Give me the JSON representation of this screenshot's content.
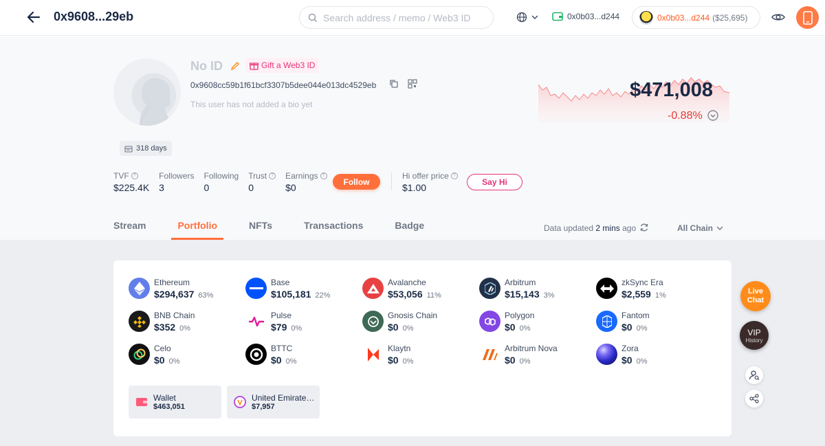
{
  "header": {
    "title": "0x9608...29eb",
    "search_placeholder": "Search address / memo / Web3 ID",
    "wallet_short": "0x0b03...d244",
    "account_addr": "0x0b03...d244",
    "account_value": "($25,695)"
  },
  "profile": {
    "name": "No ID",
    "gift_label": "Gift a Web3 ID",
    "address": "0x9608cc59b1f61bcf3307b5dee044e013dc4529eb",
    "bio": "This user has not added a bio yet",
    "days": "318 days",
    "net_worth": "$471,008",
    "change": "-0.88%",
    "stats": [
      {
        "label": "TVF",
        "value": "$225.4K"
      },
      {
        "label": "Followers",
        "value": "3"
      },
      {
        "label": "Following",
        "value": "0"
      },
      {
        "label": "Trust",
        "value": "0"
      },
      {
        "label": "Earnings",
        "value": "$0"
      }
    ],
    "follow_label": "Follow",
    "hi_offer_label": "Hi offer price",
    "hi_offer_value": "$1.00",
    "say_hi_label": "Say Hi"
  },
  "tabs": [
    "Stream",
    "Portfolio",
    "NFTs",
    "Transactions",
    "Badge"
  ],
  "data_updated": {
    "prefix": "Data updated",
    "time": "2 mins",
    "suffix": "ago"
  },
  "chain_filter": "All Chain",
  "chains": [
    {
      "name": "Ethereum",
      "value": "$294,637",
      "pct": "63%",
      "icon": "ethereum-icon",
      "color": "#627eea"
    },
    {
      "name": "Base",
      "value": "$105,181",
      "pct": "22%",
      "icon": "base-icon",
      "color": "#0052ff"
    },
    {
      "name": "Avalanche",
      "value": "$53,056",
      "pct": "11%",
      "icon": "avalanche-icon",
      "color": "#e84142"
    },
    {
      "name": "Arbitrum",
      "value": "$15,143",
      "pct": "3%",
      "icon": "arbitrum-icon",
      "color": "#213147"
    },
    {
      "name": "zkSync Era",
      "value": "$2,559",
      "pct": "1%",
      "icon": "zksync-icon",
      "color": "#000000"
    },
    {
      "name": "BNB Chain",
      "value": "$352",
      "pct": "0%",
      "icon": "bnb-icon",
      "color": "#1a1a1a"
    },
    {
      "name": "Pulse",
      "value": "$79",
      "pct": "0%",
      "icon": "pulse-icon",
      "color": "#ffffff"
    },
    {
      "name": "Gnosis Chain",
      "value": "$0",
      "pct": "0%",
      "icon": "gnosis-icon",
      "color": "#3e6957"
    },
    {
      "name": "Polygon",
      "value": "$0",
      "pct": "0%",
      "icon": "polygon-icon",
      "color": "#8247e5"
    },
    {
      "name": "Fantom",
      "value": "$0",
      "pct": "0%",
      "icon": "fantom-icon",
      "color": "#1969ff"
    },
    {
      "name": "Celo",
      "value": "$0",
      "pct": "0%",
      "icon": "celo-icon",
      "color": "#111111"
    },
    {
      "name": "BTTC",
      "value": "$0",
      "pct": "0%",
      "icon": "bttc-icon",
      "color": "#000000"
    },
    {
      "name": "Klaytn",
      "value": "$0",
      "pct": "0%",
      "icon": "klaytn-icon",
      "color": "#ffffff"
    },
    {
      "name": "Arbitrum Nova",
      "value": "$0",
      "pct": "0%",
      "icon": "arbitrum-nova-icon",
      "color": "#ffffff"
    },
    {
      "name": "Zora",
      "value": "$0",
      "pct": "0%",
      "icon": "zora-icon",
      "color": "#3b3fce"
    }
  ],
  "wallets": [
    {
      "name": "Wallet",
      "value": "$463,051"
    },
    {
      "name": "United Emirates...",
      "value": "$7,957"
    }
  ],
  "floating": {
    "live_line1": "Live",
    "live_line2": "Chat",
    "vip": "VIP",
    "vip_sub": "History"
  },
  "colors": {
    "accent": "#ff6f3c",
    "negative": "#e53935",
    "pink": "#e7337a"
  }
}
